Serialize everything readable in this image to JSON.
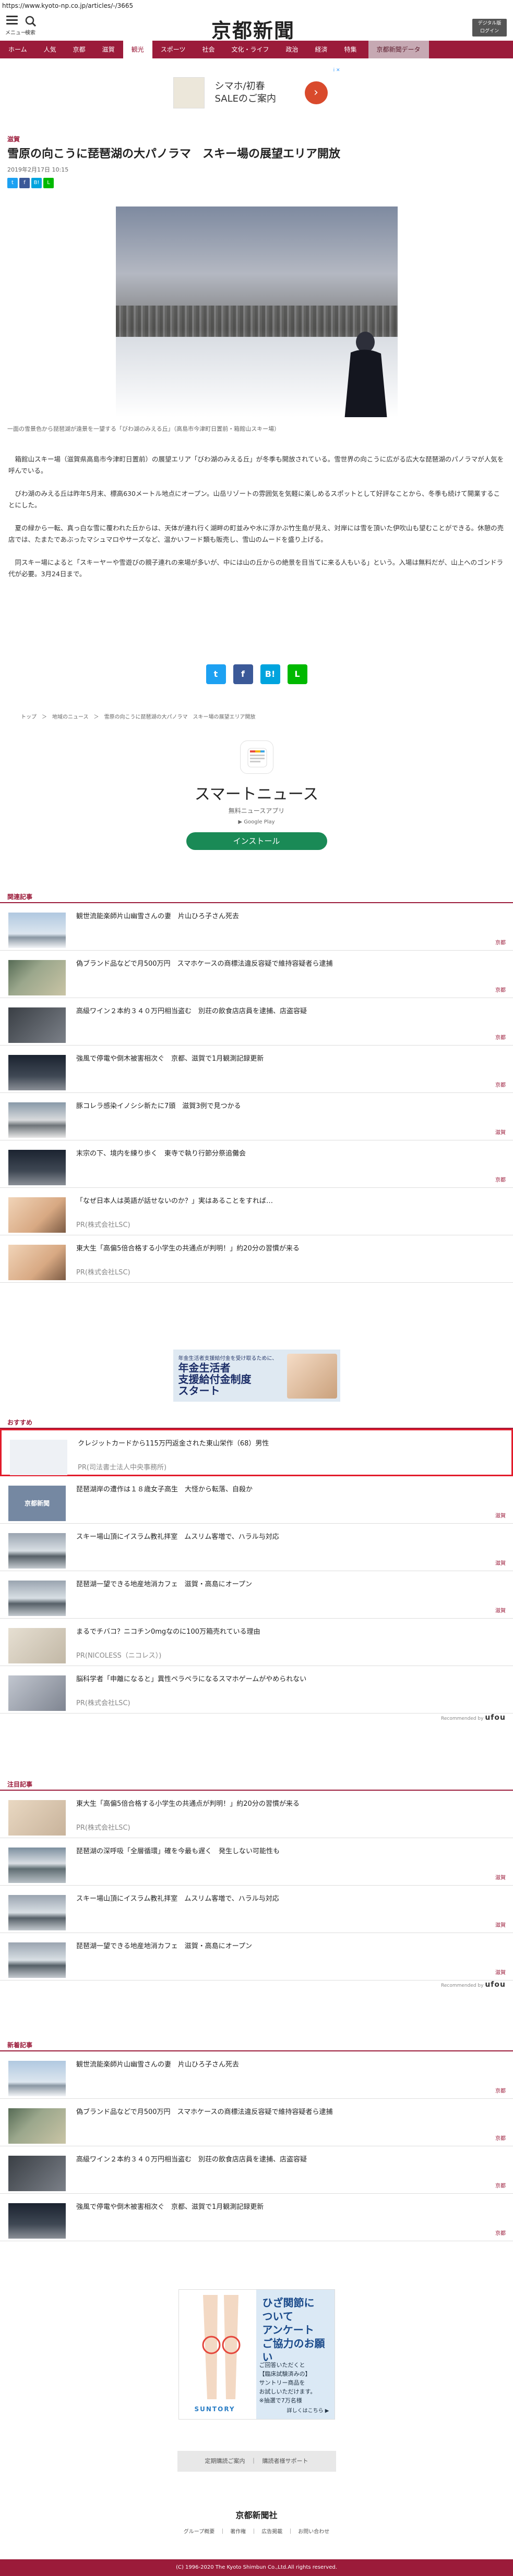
{
  "browser": {
    "url": "https://www.kyoto-np.co.jp/articles/-/3665"
  },
  "header": {
    "menu_label": "メニュー",
    "search_label": "検索",
    "logo": "京都新聞",
    "digital_label": "デジタル版\nログイン"
  },
  "nav": {
    "items": [
      "ホーム",
      "人気",
      "京都",
      "滋賀",
      "観光",
      "スポーツ",
      "社会",
      "文化・ライフ",
      "政治",
      "経済",
      "特集"
    ],
    "active_index": 4,
    "subscribe": "京都新聞データ"
  },
  "top_ad": {
    "marker": "i ✕",
    "text": "シマホ/初春\nSALEのご案内",
    "arrow": "›"
  },
  "article": {
    "section": "滋賀",
    "title": "雪原の向こうに琵琶湖の大パノラマ　スキー場の展望エリア開放",
    "date": "2019年2月17日 10:15",
    "caption": "一面の雪景色から琵琶湖が遠景を一望する「びわ湖のみえる丘」（高島市今津町日置前・箱館山スキー場）",
    "paragraphs": [
      "　箱館山スキー場（滋賀県高島市今津町日置前）の展望エリア「びわ湖のみえる丘」が冬季も開放されている。雪世界の向こうに広がる広大な琵琶湖のパノラマが人気を呼んでいる。",
      "　びわ湖のみえる丘は昨年5月末、標高630メートル地点にオープン。山岳リゾートの雰囲気を気軽に楽しめるスポットとして好評なことから、冬季も続けて開業することにした。",
      "　夏の緑から一転、真っ白な雪に覆われた丘からは、天体が連れ行く湖畔の町並みや水に浮かぶ竹生島が見え、対岸には雪を頂いた伊吹山も望むことができる。休憩の売店では、たまたであぶったマシュマロやサーズなど、温かいフード類も販売し、雪山のムードを盛り上げる。",
      "　同スキー場によると「スキーヤーや雪遊びの親子連れの来場が多いが、中には山の丘からの絶景を目当てに来る人もいる」という。入場は無料だが、山上へのゴンドラ代が必要。3月24日まで。"
    ],
    "share_small": [
      "t",
      "f",
      "B!",
      "L"
    ],
    "share_big": [
      "t",
      "f",
      "B!",
      "L"
    ],
    "breadcrumb": "トップ　＞　地域のニュース　＞　雪原の向こうに琵琶湖の大パノラマ　スキー場の展望エリア開放"
  },
  "smartnews": {
    "name": "スマートニュース",
    "sub": "無料ニュースアプリ",
    "store": "▶ Google Play",
    "install": "インストール"
  },
  "related": {
    "heading": "関連記事",
    "items": [
      {
        "title": "観世流能楽師片山幽雪さんの妻　片山ひろ子さん死去",
        "cat": "京都"
      },
      {
        "title": "偽ブランド品などで月500万円　スマホケースの商標法違反容疑で維持容疑者ら逮捕",
        "cat": "京都"
      },
      {
        "title": "高級ワイン２本約３４０万円相当盗む　別荘の飲食店店員を逮捕、店盗容疑",
        "cat": "京都"
      },
      {
        "title": "強風で停電や倒木被害相次ぐ　京都、滋賀で1月観測記録更新",
        "cat": "京都"
      },
      {
        "title": "豚コレラ感染イノシシ新たに7頭　滋賀3例で見つかる",
        "cat": "滋賀"
      },
      {
        "title": "末宗の下、境内を練り歩く　東寺で執り行節分祭追儺会",
        "cat": "京都"
      },
      {
        "title": "「なぜ日本人は英語が話せないのか？」実はあることをすれば…",
        "pr": "PR(株式会社LSC)"
      },
      {
        "title": "東大生「高偏5倍合格する小学生の共通点が判明！」約20分の習慣が来る",
        "pr": "PR(株式会社LSC)"
      }
    ]
  },
  "pension_ad": {
    "small": "年金生活者支援給付金を受け取るために、",
    "big": "年金生活者\n支援給付金制度\nスタート"
  },
  "osusume": {
    "heading": "おすすめ",
    "items": [
      {
        "title": "クレジットカードから115万円返金された東山栄作（68）男性",
        "pr": "PR(司法書士法人中央事務所)"
      },
      {
        "title": "琵琶湖岸の遭作は１８歳女子高生　大怪から転落、自殺か",
        "cat": "滋賀"
      },
      {
        "title": "スキー場山頂にイスラム教礼拝室　ムスリム客増で、ハラル与対応",
        "cat": "滋賀"
      },
      {
        "title": "琵琶湖一望できる地産地消カフェ　滋賀・高島にオープン",
        "cat": "滋賀"
      },
      {
        "title": "まるでチバコ？ニコチン0mgなのに100万箱売れている理由",
        "pr": "PR(NICOLESS（ニコレス）)"
      },
      {
        "title": "脳科学者「申離になると」異性ペラペラになるスマホゲームがやめられない",
        "pr": "PR(株式会社LSC)"
      }
    ],
    "powered": "Recommended by",
    "brand": "ufou"
  },
  "chumoku": {
    "heading": "注目記事",
    "items": [
      {
        "title": "東大生「高偏5倍合格する小学生の共通点が判明！」約20分の習慣が来る",
        "pr": "PR(株式会社LSC)"
      },
      {
        "title": "琵琶湖の深呼吸「全層循環」確を今最も遅く　発生しない可能性も",
        "cat": "滋賀"
      },
      {
        "title": "スキー場山頂にイスラム教礼拝室　ムスリム客増で、ハラル与対応",
        "cat": "滋賀"
      },
      {
        "title": "琵琶湖一望できる地産地消カフェ　滋賀・高島にオープン",
        "cat": "滋賀"
      }
    ],
    "powered": "Recommended by",
    "brand": "ufou"
  },
  "shinchaku": {
    "heading": "新着記事",
    "items": [
      {
        "title": "観世流能楽師片山幽雪さんの妻　片山ひろ子さん死去",
        "cat": "京都"
      },
      {
        "title": "偽ブランド品などで月500万円　スマホケースの商標法違反容疑で維持容疑者ら逮捕",
        "cat": "京都"
      },
      {
        "title": "高級ワイン２本約３４０万円相当盗む　別荘の飲食店店員を逮捕、店盗容疑",
        "cat": "京都"
      },
      {
        "title": "強風で停電や倒木被害相次ぐ　京都、滋賀で1月観測記録更新",
        "cat": "京都"
      }
    ]
  },
  "knee_ad": {
    "headline": "ひざ関節に\nついて\nアンケート\nご協力のお願い",
    "body": "ご回答いただくと\n【臨床試験済みの】\nサントリー商品を\nお試しいただけます。\n※抽選で7万名様",
    "brand": "SUNTORY",
    "detail": "詳しくはこちら ▶"
  },
  "footer": {
    "links": "定期購読ご案内　｜　購読者様サポート",
    "logo": "京都新聞社",
    "nav": "グループ概要　｜　著作権　｜　広告掲載　｜　お問い合わせ",
    "copyright": "(C) 1996-2020 The Kyoto Shimbun Co.,Ltd.All rights reserved."
  },
  "colors": {
    "brand": "#9b1b3a",
    "install": "#1a8a56",
    "highlight": "#e21b2b"
  }
}
